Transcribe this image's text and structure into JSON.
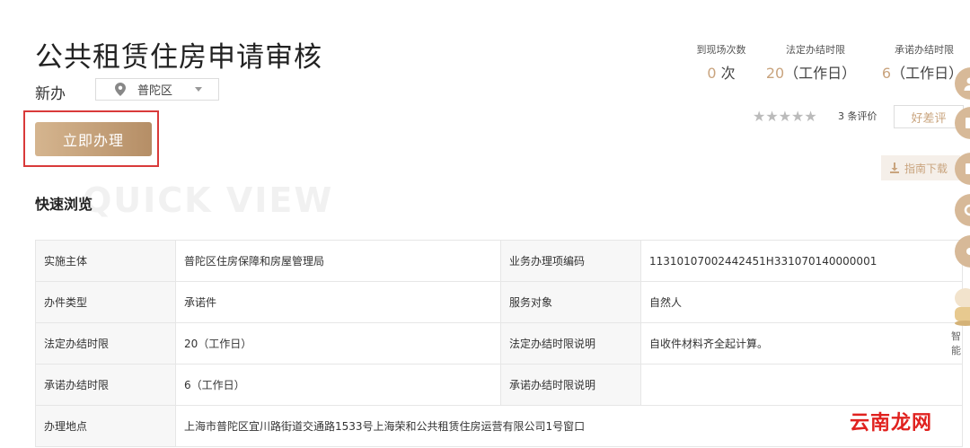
{
  "header": {
    "title": "公共租赁住房申请审核",
    "badge": "新办",
    "region": "普陀区",
    "apply_button": "立即办理"
  },
  "stats": [
    {
      "label": "到现场次数",
      "value": "0",
      "unit": "次"
    },
    {
      "label": "法定办结时限",
      "value": "20",
      "unit": "（工作日）"
    },
    {
      "label": "承诺办结时限",
      "value": "6",
      "unit": "（工作日）"
    }
  ],
  "rating": {
    "stars": "★★★★★",
    "count_text": "3 条评价",
    "eval_button": "好差评"
  },
  "guide_download": "指南下载",
  "section": {
    "watermark": "QUICK VIEW",
    "title": "快速浏览"
  },
  "info_rows": [
    {
      "k1": "实施主体",
      "v1": "普陀区住房保障和房屋管理局",
      "k2": "业务办理项编码",
      "v2": "11310107002442451H331070140000001"
    },
    {
      "k1": "办件类型",
      "v1": "承诺件",
      "k2": "服务对象",
      "v2": "自然人"
    },
    {
      "k1": "法定办结时限",
      "v1": "20（工作日）",
      "k2": "法定办结时限说明",
      "v2": "自收件材料齐全起计算。"
    },
    {
      "k1": "承诺办结时限",
      "v1": "6（工作日）",
      "k2": "承诺办结时限说明",
      "v2": ""
    },
    {
      "k1": "办理地点",
      "v1": "上海市普陀区宜川路街道交通路1533号上海荣和公共租赁住房运营有限公司1号窗口"
    }
  ],
  "side": {
    "robot_label": "智能"
  },
  "watermark": "云南龙网",
  "colors": {
    "accent": "#c9a47e",
    "button_start": "#d5b58f",
    "button_end": "#b58e66",
    "highlight": "#d93a3a"
  }
}
